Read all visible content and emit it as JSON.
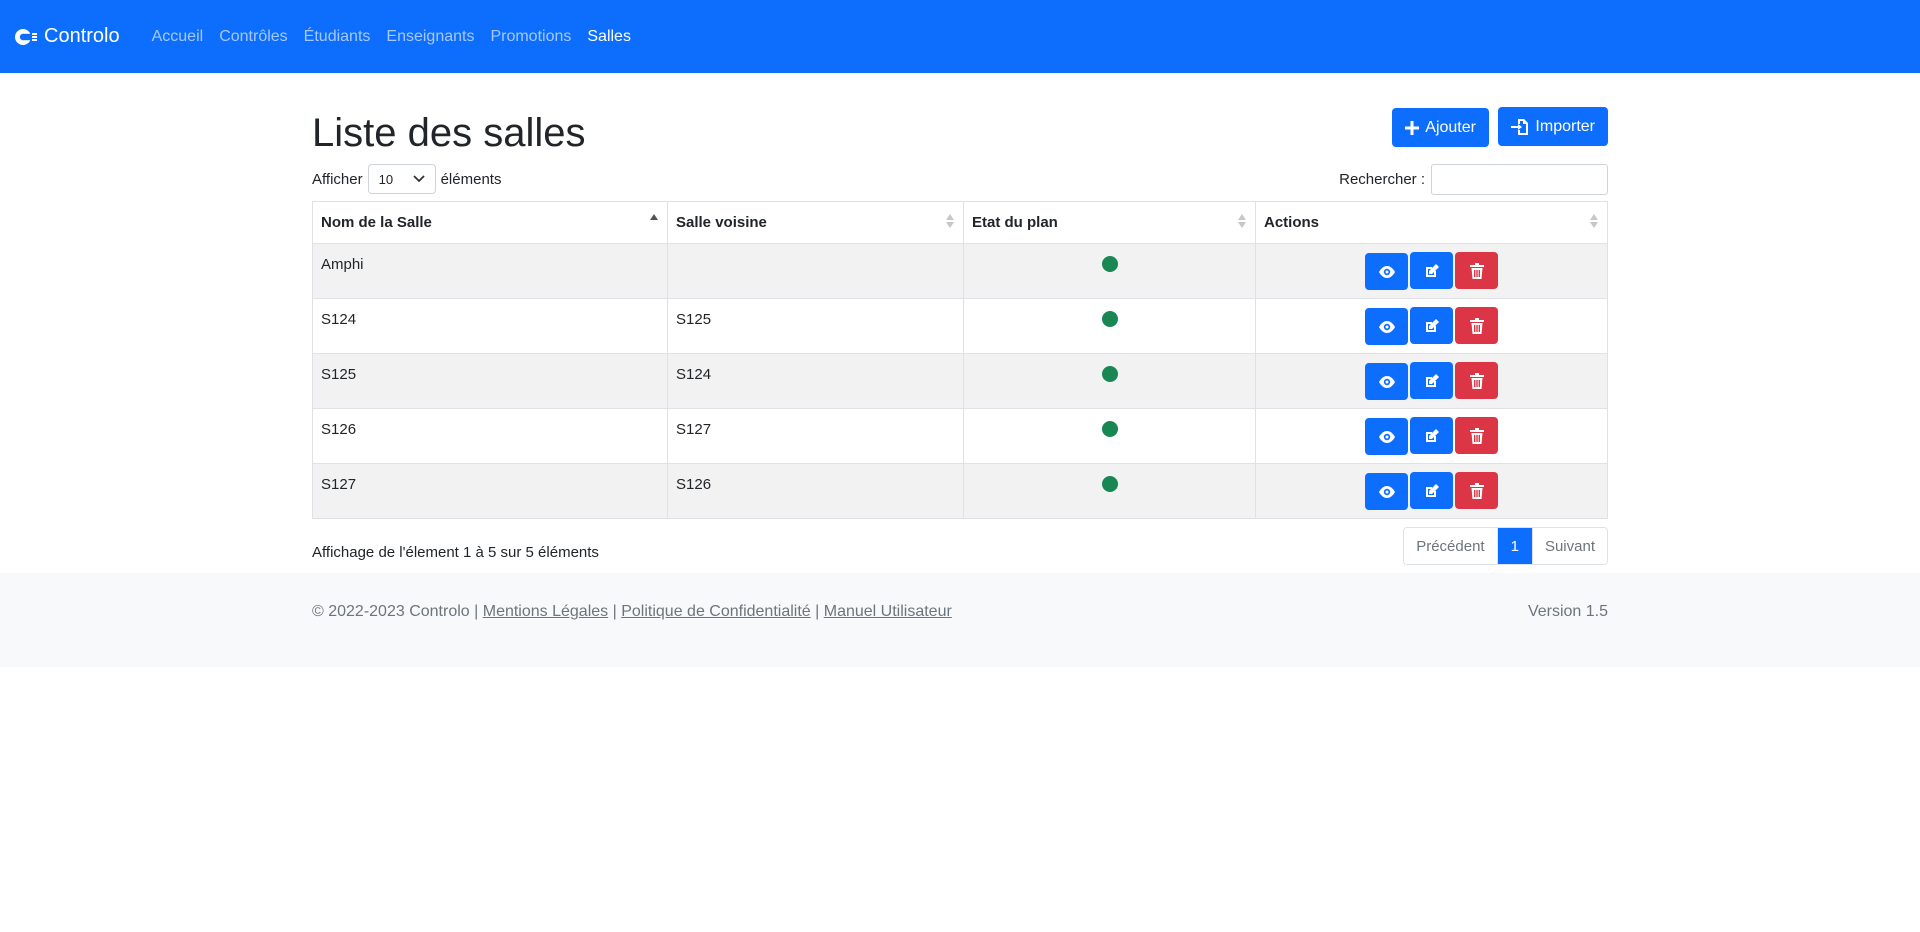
{
  "navbar": {
    "brand": "Controlo",
    "links": [
      "Accueil",
      "Contrôles",
      "Étudiants",
      "Enseignants",
      "Promotions",
      "Salles"
    ],
    "active_index": 5
  },
  "header": {
    "title": "Liste des salles",
    "add_label": "Ajouter",
    "import_label": "Importer"
  },
  "controls": {
    "show_label": "Afficher",
    "page_size": "10",
    "elements_label": "éléments",
    "search_label": "Rechercher :",
    "search_value": ""
  },
  "table": {
    "columns": [
      "Nom de la Salle",
      "Salle voisine",
      "Etat du plan",
      "Actions"
    ],
    "rows": [
      {
        "name": "Amphi",
        "neighbor": "",
        "status": "ok"
      },
      {
        "name": "S124",
        "neighbor": "S125",
        "status": "ok"
      },
      {
        "name": "S125",
        "neighbor": "S124",
        "status": "ok"
      },
      {
        "name": "S126",
        "neighbor": "S127",
        "status": "ok"
      },
      {
        "name": "S127",
        "neighbor": "S126",
        "status": "ok"
      }
    ],
    "status_color": "#198754"
  },
  "footer_info": "Affichage de l'élement 1 à 5 sur 5 éléments",
  "pagination": {
    "prev": "Précédent",
    "current": "1",
    "next": "Suivant"
  },
  "footer": {
    "copyright": "© 2022-2023 Controlo |",
    "links": [
      "Mentions Légales",
      "Politique de Confidentialité",
      "Manuel Utilisateur"
    ],
    "sep": "|",
    "version": "Version 1.5"
  },
  "colors": {
    "primary": "#0d6efd",
    "danger": "#dc3545",
    "success": "#198754"
  }
}
